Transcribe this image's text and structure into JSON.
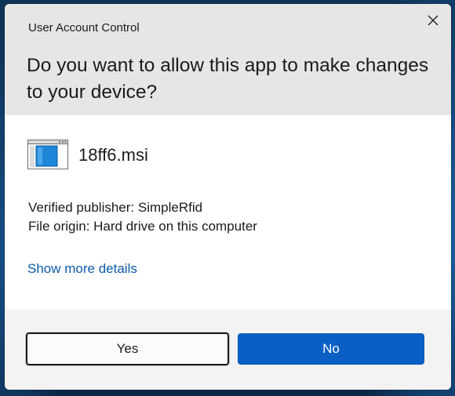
{
  "window": {
    "title": "User Account Control",
    "close_icon": "close-icon"
  },
  "prompt": {
    "question": "Do you want to allow this app to make changes to your device?"
  },
  "program": {
    "icon": "installer-window-icon",
    "name": "18ff6.msi",
    "publisher_line": "Verified publisher: SimpleRfid",
    "origin_line": "File origin: Hard drive on this computer"
  },
  "links": {
    "show_more": "Show more details"
  },
  "buttons": {
    "yes": "Yes",
    "no": "No"
  },
  "colors": {
    "accent": "#0a5fc4",
    "link": "#0a5aa8",
    "header_bg": "#e6e6e6"
  }
}
